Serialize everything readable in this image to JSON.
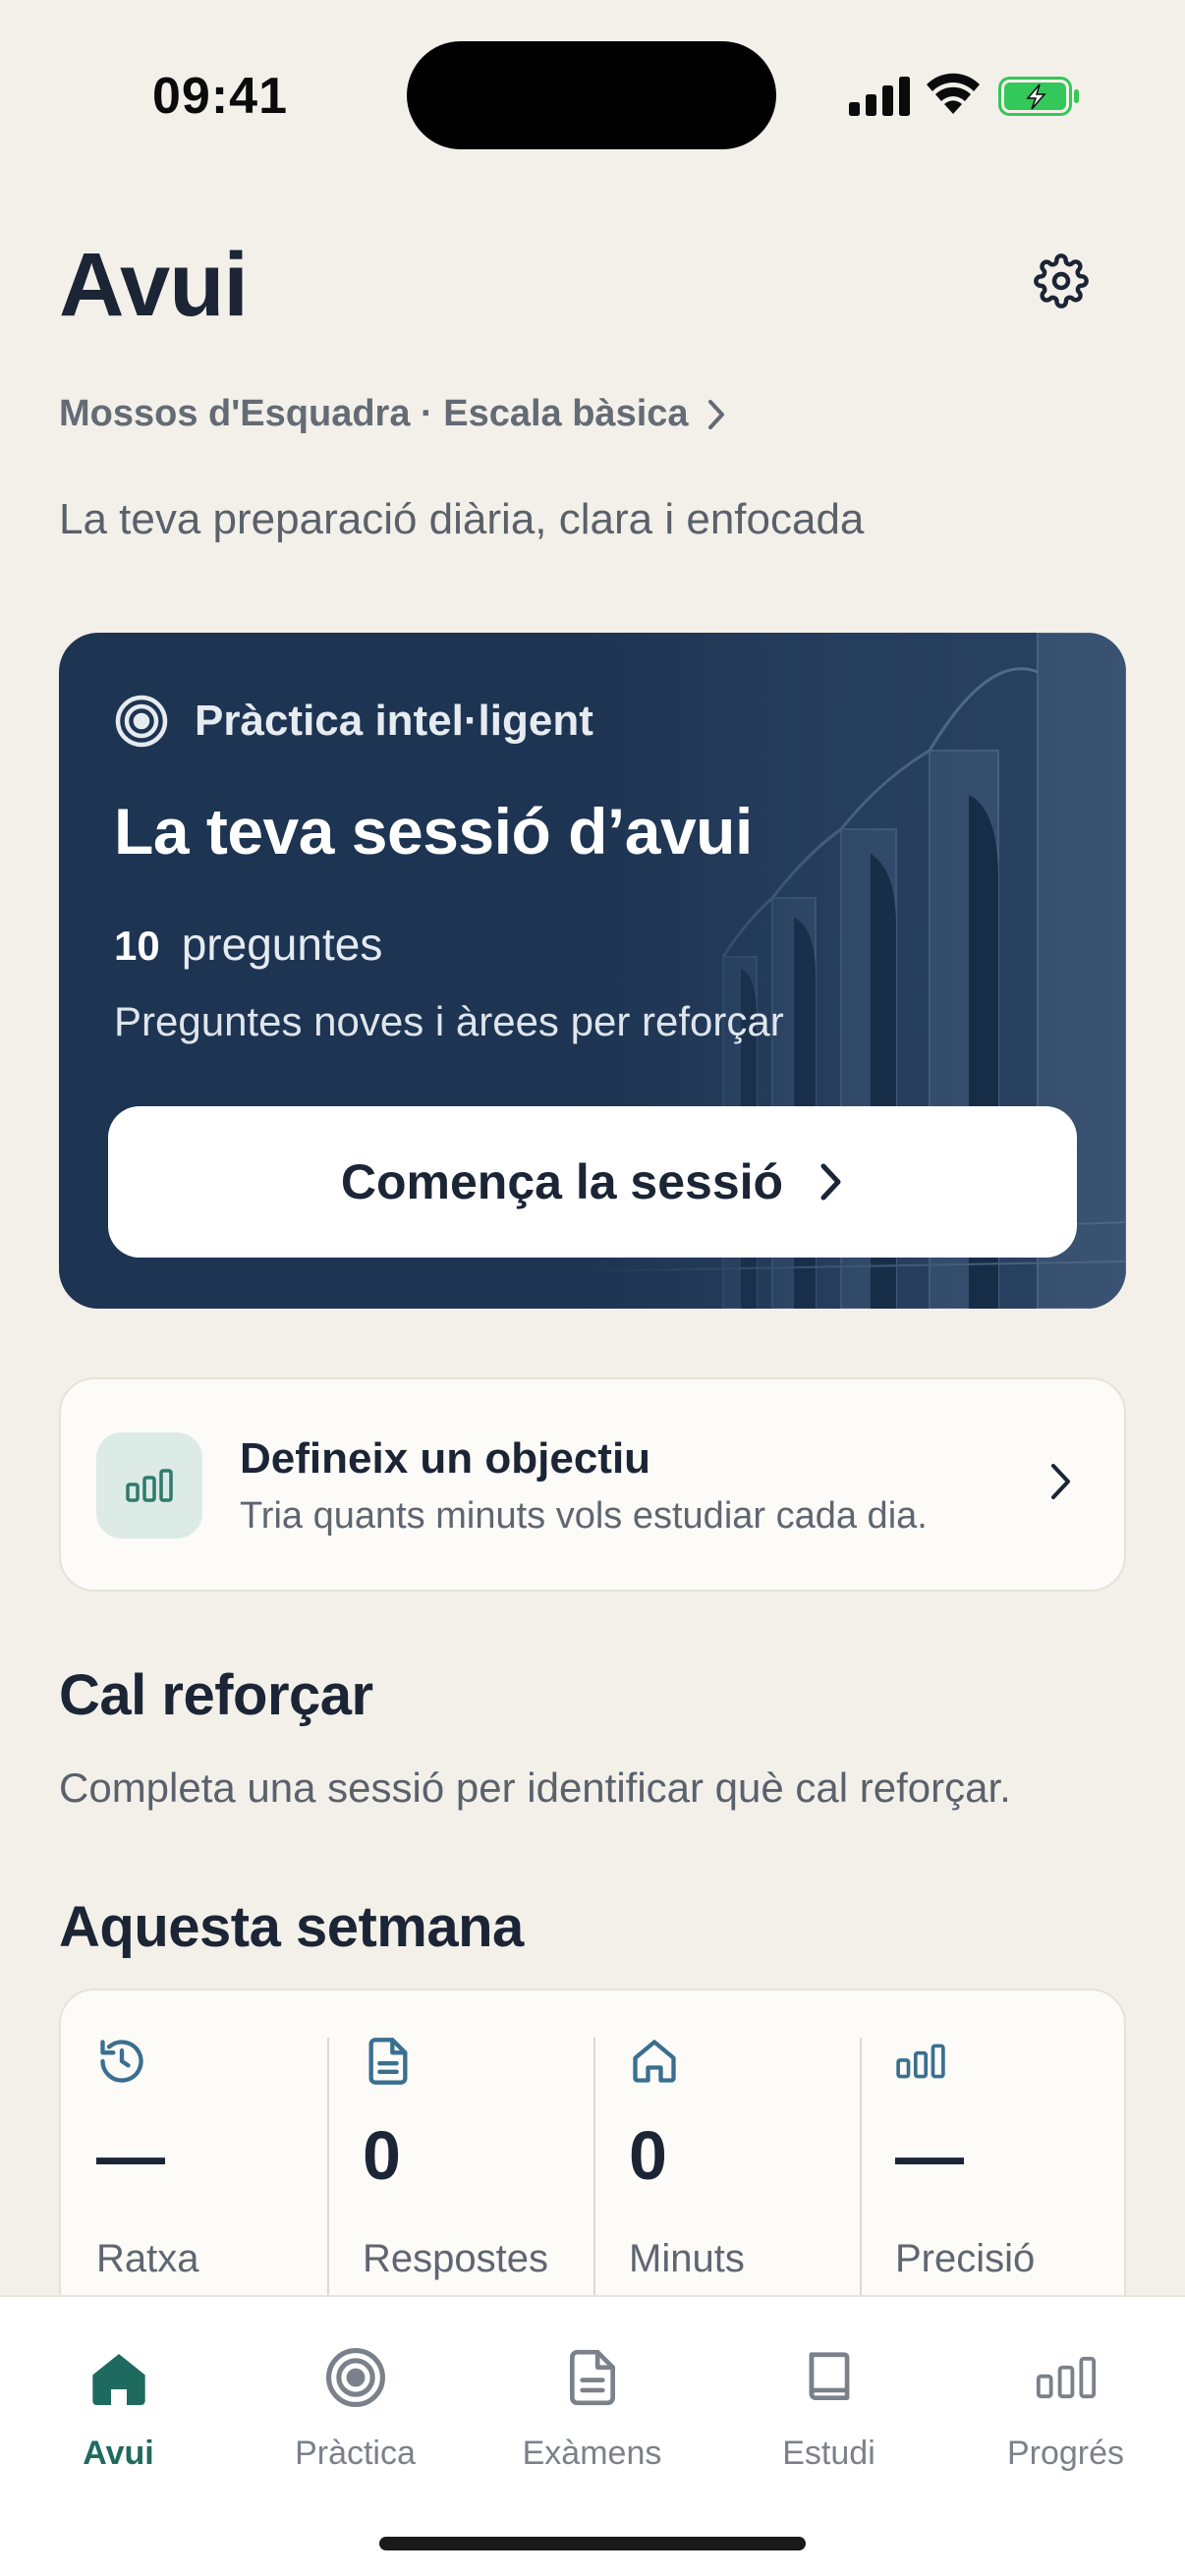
{
  "status_bar": {
    "time": "09:41"
  },
  "header": {
    "title": "Avui",
    "breadcrumb": "Mossos d'Esquadra · Escala bàsica",
    "subtitle": "La teva preparació diària, clara i enfocada"
  },
  "hero": {
    "eyebrow": "Pràctica intel·ligent",
    "title": "La teva sessió d’avui",
    "count": "10",
    "count_unit": "preguntes",
    "description": "Preguntes noves i àrees per reforçar",
    "cta_label": "Comença la sessió"
  },
  "goal": {
    "title": "Defineix un objectiu",
    "description": "Tria quants minuts vols estudiar cada dia."
  },
  "reforcar": {
    "title": "Cal reforçar",
    "description": "Completa una sessió per identificar què cal reforçar."
  },
  "week": {
    "title": "Aquesta setmana",
    "stats": [
      {
        "icon": "history-icon",
        "value": "—",
        "label": "Ratxa actual"
      },
      {
        "icon": "document-icon",
        "value": "0",
        "label": "Respostes"
      },
      {
        "icon": "home-icon",
        "value": "0",
        "label": "Minuts"
      },
      {
        "icon": "bar-chart-icon",
        "value": "—",
        "label": "Precisió"
      }
    ]
  },
  "tabs": [
    {
      "label": "Avui",
      "icon": "home-icon",
      "active": true
    },
    {
      "label": "Pràctica",
      "icon": "target-icon",
      "active": false
    },
    {
      "label": "Exàmens",
      "icon": "document-icon",
      "active": false
    },
    {
      "label": "Estudi",
      "icon": "book-icon",
      "active": false
    },
    {
      "label": "Progrés",
      "icon": "bar-chart-icon",
      "active": false
    }
  ],
  "colors": {
    "background": "#f3f0ea",
    "hero": "#1d3452",
    "accent_teal": "#1f6a5e",
    "text_primary": "#1b2535",
    "text_secondary": "#5b616b"
  }
}
